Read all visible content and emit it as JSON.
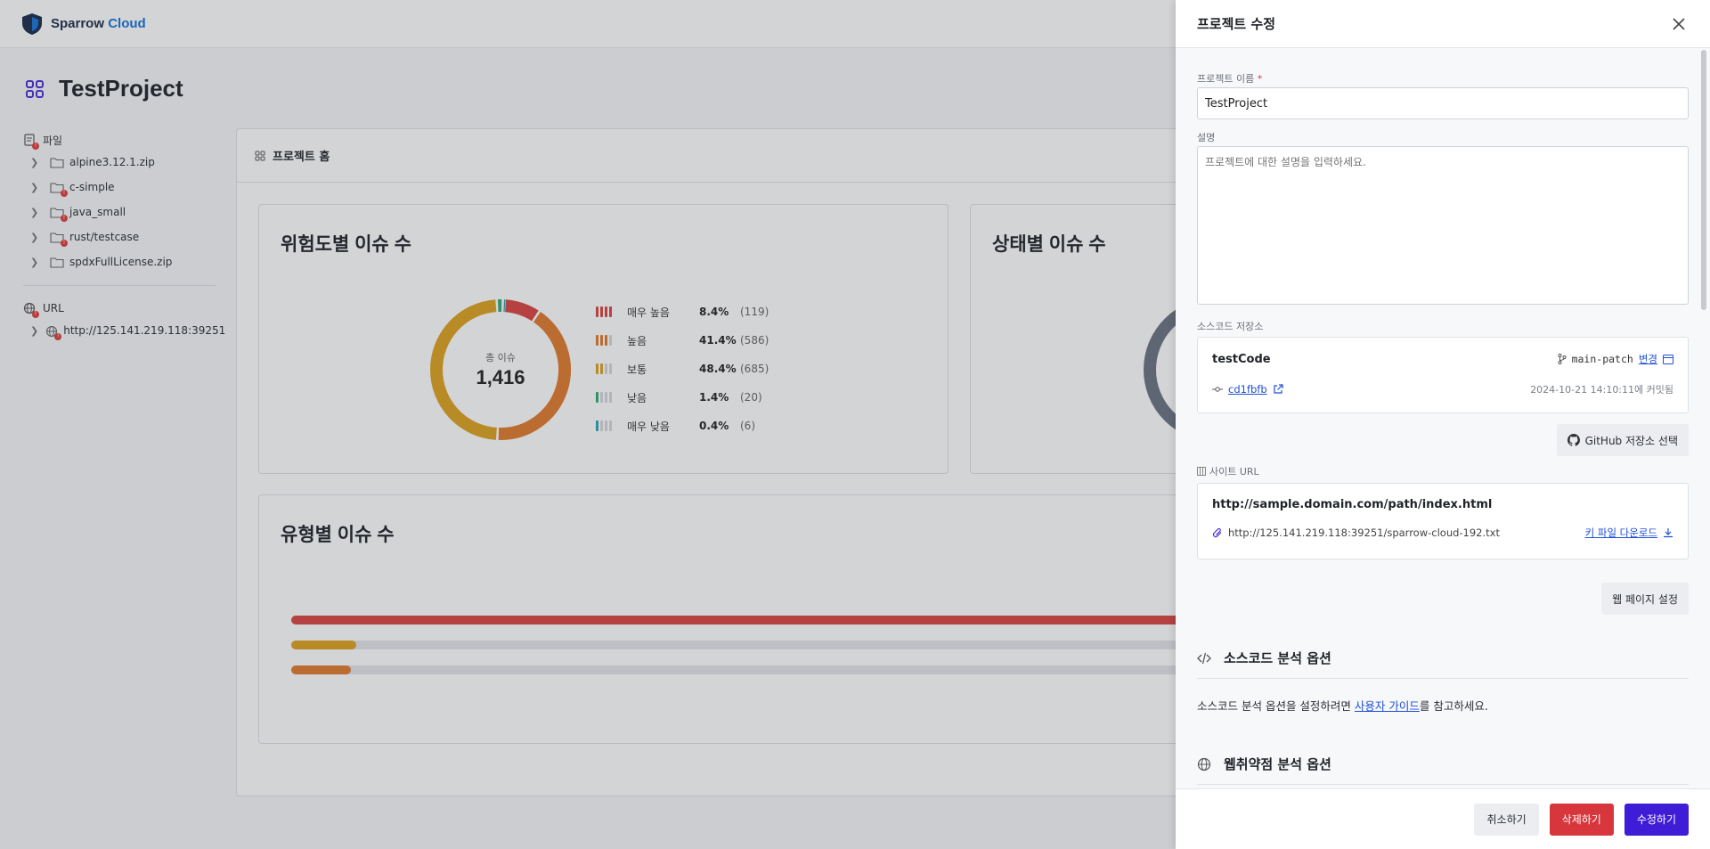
{
  "app": {
    "logo_text_1": "Sparrow",
    "logo_text_2": "Cloud"
  },
  "project": {
    "title": "TestProject"
  },
  "sidebar": {
    "file_group": "파일",
    "files": [
      "alpine3.12.1.zip",
      "c-simple",
      "java_small",
      "rust/testcase",
      "spdxFullLicense.zip"
    ],
    "url_group": "URL",
    "urls": [
      "http://125.141.219.118:39251"
    ]
  },
  "content": {
    "tab_title": "프로젝트 홈",
    "severity_card_title": "위험도별 이슈 수",
    "status_card_title": "상태별 이슈 수",
    "type_card_title": "유형별 이슈 수",
    "donut_label": "총 이슈",
    "donut_total": "1,416"
  },
  "chart_data": {
    "type": "pie",
    "title": "위험도별 이슈 수",
    "categories": [
      "매우 높음",
      "높음",
      "보통",
      "낮음",
      "매우 낮음"
    ],
    "values": [
      119,
      586,
      685,
      20,
      6
    ],
    "percents": [
      "8.4%",
      "41.4%",
      "48.4%",
      "1.4%",
      "0.4%"
    ],
    "counts": [
      "(119)",
      "(586)",
      "(685)",
      "(20)",
      "(6)"
    ],
    "colors": [
      "#d9443f",
      "#e07a2c",
      "#dda21e",
      "#2eaa6e",
      "#2aa6b5"
    ],
    "level_bars": [
      4,
      3,
      2,
      1,
      1
    ]
  },
  "type_bars": [
    {
      "fraction": 1.0,
      "color": "#d9443f"
    },
    {
      "fraction": 0.052,
      "color": "#dda21e"
    },
    {
      "fraction": 0.048,
      "color": "#e07a2c"
    }
  ],
  "drawer": {
    "title": "프로젝트 수정",
    "name_label": "프로젝트 이름",
    "required_mark": "*",
    "name_value": "TestProject",
    "desc_label": "설명",
    "desc_placeholder": "프로젝트에 대한 설명을 입력하세요.",
    "repo_label": "소스코드 저장소",
    "repo_name": "testCode",
    "branch": "main-patch",
    "change_link": "변경",
    "commit_hash": "cd1fbfb",
    "commit_date": "2024-10-21 14:10:11에 커밋됨",
    "github_button": "GitHub 저장소 선택",
    "site_label": "사이트 URL",
    "site_url": "http://sample.domain.com/path/index.html",
    "key_url": "http://125.141.219.118:39251/sparrow-cloud-192.txt",
    "key_download": "키 파일 다운로드",
    "web_settings_button": "웹 페이지 설정",
    "source_options_title": "소스코드 분석 옵션",
    "guide_prefix": "소스코드 분석 옵션을 설정하려면 ",
    "guide_link": "사용자 가이드",
    "guide_suffix": "를 참고하세요.",
    "web_options_title": "웹취약점 분석 옵션",
    "cancel": "취소하기",
    "delete": "삭제하기",
    "submit": "수정하기"
  },
  "colors": {
    "accent": "#3f1dd6",
    "danger": "#d8363d",
    "brand": "#1573d6",
    "link": "#1f4fd6"
  }
}
